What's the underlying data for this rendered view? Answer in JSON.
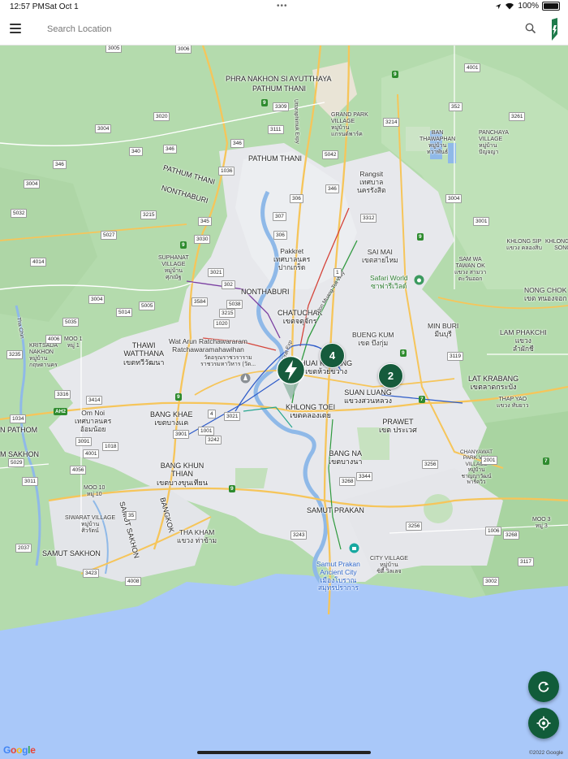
{
  "status_bar": {
    "time": "12:57 PM",
    "date": "Sat Oct 1",
    "battery": "100%"
  },
  "header": {
    "search_placeholder": "Search Location"
  },
  "map": {
    "places": [
      {
        "id": "phra",
        "text": "PHRA NAKHON SI AYUTTHAYA"
      },
      {
        "id": "pathum1",
        "text": "PATHUM THANI"
      },
      {
        "id": "grandpark",
        "text": "GRAND PARK\nVILLAGE\nหมู่บ้าน\nแกรนด์พาร์ค"
      },
      {
        "id": "panchaya",
        "text": "PANCHAYA\nVILLAGE\nหมู่บ้าน\nปัญจญา"
      },
      {
        "id": "pathum2",
        "text": "PATHUM THANI"
      },
      {
        "id": "ban",
        "text": "BAN\nTHAWAPHAN\nหมู่บ้าน\nทวาพันธ์"
      },
      {
        "id": "pathumthani3",
        "text": "PATHUM THANI"
      },
      {
        "id": "rangsit",
        "text": "Rangsit\nเทศบาล\nนครรังสิต"
      },
      {
        "id": "nonthaburi1",
        "text": "NONTHABURI"
      },
      {
        "id": "pakkret",
        "text": "Pakkret\nเทศบาลนคร\nปากเกร็ด"
      },
      {
        "id": "saimai",
        "text": "SAI MAI\nเขตสายไหม"
      },
      {
        "id": "khlongsip",
        "text": "KHLONG SIP\nแขวง คลองสิบ"
      },
      {
        "id": "khlongsipsong",
        "text": "KHLONG SIP\nSONG"
      },
      {
        "id": "suphanat",
        "text": "SUPHANAT\nVILLAGE\nหมู่บ้าน\nศุภณัฐ"
      },
      {
        "id": "sansab",
        "text": "SAM WA\nTAWAN OK\nแขวง สามวา\nตะวันออก"
      },
      {
        "id": "safari",
        "text": "Safari World\nซาฟารีเวิลด์"
      },
      {
        "id": "nonthaburi2",
        "text": "NONTHABURI"
      },
      {
        "id": "nongchok",
        "text": "NONG CHOK\nเขต หนองจอก"
      },
      {
        "id": "chatuchak",
        "text": "CHATUCHAK\nเขตจตุจักร"
      },
      {
        "id": "watarun",
        "text": "Wat Arun Ratchawararam\nRatchawaramahawihan"
      },
      {
        "id": "watarunth",
        "text": "วัดอรุณราชวราราม\nราชวรมหาวิหาร (วัด..."
      },
      {
        "id": "buengkum",
        "text": "BUENG KUM\nเขต บึงกุ่ม"
      },
      {
        "id": "minburi",
        "text": "MIN BURI\nมีนบุรี"
      },
      {
        "id": "lamphakchi",
        "text": "LAM PHAKCHI\nแขวง\nลำผักชี"
      },
      {
        "id": "krisada",
        "text": "KRITSADA\nNAKHON\nหมู่บ้าน\nกฤษดานคร"
      },
      {
        "id": "moo1",
        "text": "MOO 1\nหมู่ 1"
      },
      {
        "id": "thawi",
        "text": "THAWI\nWATTHANA\nเขตทวีวัฒนา"
      },
      {
        "id": "huaikhwang",
        "text": "HUAI KHWANG\nเขตห้วยขวาง"
      },
      {
        "id": "suanluang",
        "text": "SUAN LUANG\nแขวงสวนหลวง"
      },
      {
        "id": "latkrabang",
        "text": "LAT KRABANG\nเขตลาดกระบัง"
      },
      {
        "id": "omnoi",
        "text": "Om Noi\nเทศบาลนคร\nอ้อมน้อย"
      },
      {
        "id": "bangkhae",
        "text": "BANG KHAE\nเขตบางแค"
      },
      {
        "id": "khlongtoei",
        "text": "KHLONG TOEI\nเขตคลองเตย"
      },
      {
        "id": "prawet",
        "text": "PRAWET\nเขต ประเวศ"
      },
      {
        "id": "thapyao",
        "text": "THAP YAO\nแขวง ทับยาว"
      },
      {
        "id": "pathom",
        "text": "N PATHOM"
      },
      {
        "id": "sakhon1",
        "text": "M SAKHON"
      },
      {
        "id": "bangna",
        "text": "BANG NA\nเขตบางนา"
      },
      {
        "id": "bangkhunthian",
        "text": "BANG KHUN\nTHIAN\nเขตบางขุนเทียน"
      },
      {
        "id": "chanyawat",
        "text": "CHANYAWAT\nPARK VILL\nVILLAGE\nหมู่บ้าน\nชาญญาวัฒน์\nพาร์ควิว"
      },
      {
        "id": "moo10",
        "text": "MOO 10\nหมู่ 10"
      },
      {
        "id": "samutsakhon_v",
        "text": "SAMUT SAKHON"
      },
      {
        "id": "bangkok_v",
        "text": "BANGKOK"
      },
      {
        "id": "moo3",
        "text": "MOO 3\nหมู่ 3"
      },
      {
        "id": "siwarat",
        "text": "SIWARAT VILLAGE\nหมู่บ้าน\nศิวรัตน์"
      },
      {
        "id": "samutprakan",
        "text": "SAMUT PRAKAN"
      },
      {
        "id": "thakham",
        "text": "THA KHAM\nแขวง ท่าข้าม"
      },
      {
        "id": "samutsakhon2",
        "text": "SAMUT SAKHON"
      },
      {
        "id": "cityvillage",
        "text": "CITY VILLAGE\nหมู่บ้าน\nซิตี้ วิลเลจ"
      },
      {
        "id": "ancient",
        "text": "Samut Prakan\nAncient City\nเมืองโบราณ\nสมุทรปราการ"
      }
    ],
    "road_shields": [
      {
        "id": "r3006a",
        "text": "3006"
      },
      {
        "id": "r3005",
        "text": "3005"
      },
      {
        "id": "r3309",
        "text": "3309"
      },
      {
        "id": "r3020",
        "text": "3020"
      },
      {
        "id": "r3004a",
        "text": "3004"
      },
      {
        "id": "r340",
        "text": "340"
      },
      {
        "id": "r346a",
        "text": "346"
      },
      {
        "id": "r3111",
        "text": "3111"
      },
      {
        "id": "r346b",
        "text": "346"
      },
      {
        "id": "r3214",
        "text": "3214"
      },
      {
        "id": "r352",
        "text": "352"
      },
      {
        "id": "r3261",
        "text": "3261"
      },
      {
        "id": "r4001",
        "text": "4001"
      },
      {
        "id": "r5042",
        "text": "5042"
      },
      {
        "id": "r3004b",
        "text": "3004"
      },
      {
        "id": "r346c",
        "text": "346"
      },
      {
        "id": "r1036",
        "text": "1036"
      },
      {
        "id": "r306a",
        "text": "306"
      },
      {
        "id": "r346d",
        "text": "346"
      },
      {
        "id": "r3215",
        "text": "3215"
      },
      {
        "id": "r307",
        "text": "307"
      },
      {
        "id": "r3312",
        "text": "3312"
      },
      {
        "id": "r3004c",
        "text": "3004"
      },
      {
        "id": "r3004d",
        "text": "3004"
      },
      {
        "id": "r5032",
        "text": "5032"
      },
      {
        "id": "r345",
        "text": "345"
      },
      {
        "id": "r306b",
        "text": "306"
      },
      {
        "id": "r5027",
        "text": "5027"
      },
      {
        "id": "r3030",
        "text": "3030"
      },
      {
        "id": "r3001",
        "text": "3001"
      },
      {
        "id": "r4014",
        "text": "4014"
      },
      {
        "id": "r3021a",
        "text": "3021"
      },
      {
        "id": "r302",
        "text": "302"
      },
      {
        "id": "r1",
        "text": "1"
      },
      {
        "id": "r3004e",
        "text": "3004"
      },
      {
        "id": "r3584",
        "text": "3584"
      },
      {
        "id": "r5038",
        "text": "5038"
      },
      {
        "id": "r5005",
        "text": "5005"
      },
      {
        "id": "r5014",
        "text": "5014"
      },
      {
        "id": "r3215b",
        "text": "3215"
      },
      {
        "id": "r5035",
        "text": "5035"
      },
      {
        "id": "r1020",
        "text": "1020"
      },
      {
        "id": "r4006",
        "text": "4006"
      },
      {
        "id": "r3235",
        "text": "3235"
      },
      {
        "id": "r3119",
        "text": "3119"
      },
      {
        "id": "r3316",
        "text": "3316"
      },
      {
        "id": "r3414",
        "text": "3414"
      },
      {
        "id": "r4",
        "text": "4"
      },
      {
        "id": "r3021b",
        "text": "3021"
      },
      {
        "id": "r3901",
        "text": "3901"
      },
      {
        "id": "r1001",
        "text": "1001"
      },
      {
        "id": "r3242",
        "text": "3242"
      },
      {
        "id": "r1034",
        "text": "1034"
      },
      {
        "id": "r3091",
        "text": "3091"
      },
      {
        "id": "r1018",
        "text": "1018"
      },
      {
        "id": "r4001b",
        "text": "4001"
      },
      {
        "id": "r5029",
        "text": "5029"
      },
      {
        "id": "r3256",
        "text": "3256"
      },
      {
        "id": "r2001",
        "text": "2001"
      },
      {
        "id": "r4056",
        "text": "4056"
      },
      {
        "id": "r3011",
        "text": "3011"
      },
      {
        "id": "r3268",
        "text": "3268"
      },
      {
        "id": "r3344",
        "text": "3344"
      },
      {
        "id": "r35",
        "text": "35"
      },
      {
        "id": "r3256b",
        "text": "3256"
      },
      {
        "id": "r1006",
        "text": "1006"
      },
      {
        "id": "r3268b",
        "text": "3268"
      },
      {
        "id": "r2037",
        "text": "2037"
      },
      {
        "id": "r3243",
        "text": "3243"
      },
      {
        "id": "r3117",
        "text": "3117"
      },
      {
        "id": "r3423",
        "text": "3423"
      },
      {
        "id": "r4008",
        "text": "4008"
      },
      {
        "id": "r3002",
        "text": "3002"
      },
      {
        "id": "r3004f",
        "text": "3004"
      },
      {
        "id": "r4001c",
        "text": "4001"
      }
    ],
    "highway_shields": [
      {
        "id": "h9a",
        "text": "9"
      },
      {
        "id": "h9b",
        "text": "9"
      },
      {
        "id": "h9c",
        "text": "9"
      },
      {
        "id": "h9d",
        "text": "9"
      },
      {
        "id": "h9e",
        "text": "9"
      },
      {
        "id": "h9f",
        "text": "9"
      },
      {
        "id": "h9g",
        "text": "9"
      },
      {
        "id": "h9h",
        "text": "9"
      },
      {
        "id": "h7",
        "text": "7"
      },
      {
        "id": "h7b",
        "text": "7"
      },
      {
        "id": "hah2",
        "text": "AH2"
      },
      {
        "id": "h9i",
        "text": "9"
      }
    ],
    "road_names": [
      {
        "id": "uttaraphimuk",
        "text": "Uttaraphimuk Expy"
      },
      {
        "id": "donmuang",
        "text": "Don Muang Toll Way"
      },
      {
        "id": "sirat",
        "text": "Sirat Exp"
      },
      {
        "id": "thachin",
        "text": "Tha Chin"
      }
    ],
    "markers": {
      "cluster_a": "4",
      "cluster_b": "2"
    },
    "copyright": "©2022 Google",
    "google_logo": "Google"
  },
  "colors": {
    "brand": "#115c3a",
    "water": "#a9c8f9",
    "urban": "#e8e8ec",
    "green": "#b7dcb0"
  }
}
